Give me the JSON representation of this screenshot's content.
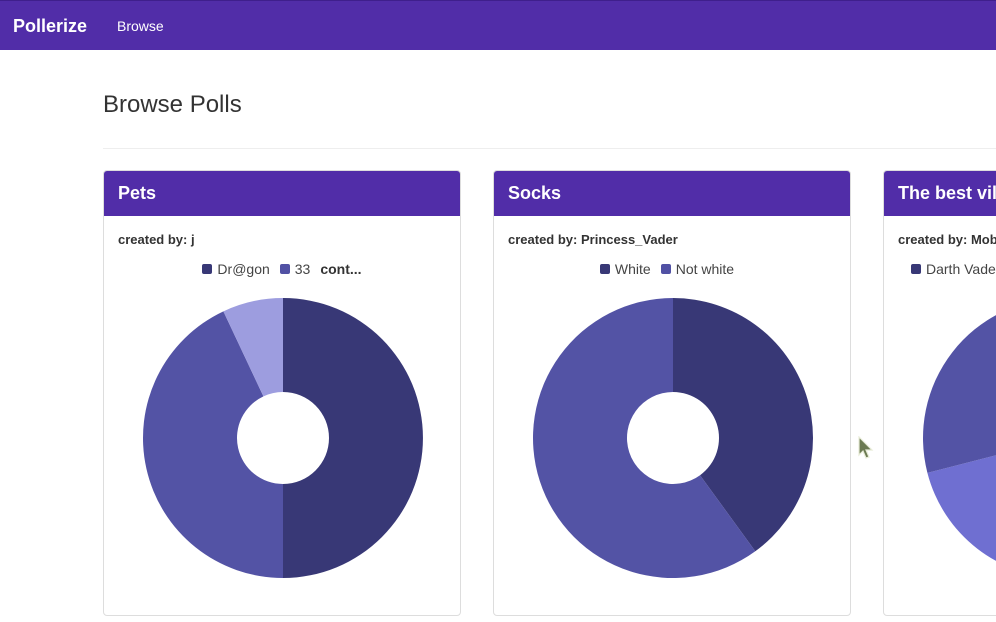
{
  "app": {
    "brand": "Pollerize",
    "nav": {
      "browse_label": "Browse"
    }
  },
  "page": {
    "title": "Browse Polls"
  },
  "polls": [
    {
      "title": "Pets",
      "creator": "created by: j",
      "legend": [
        {
          "label": "Dr@gon",
          "color": "#383876"
        },
        {
          "label": "33",
          "color": "#5151a4"
        }
      ],
      "legend_more": "cont...",
      "chart_data": {
        "type": "pie",
        "donut": true,
        "labels": [
          "Dr@gon",
          "33",
          ""
        ],
        "values": [
          50,
          43,
          7
        ],
        "colors": [
          "#383876",
          "#5353a5",
          "#9d9ddf"
        ]
      }
    },
    {
      "title": "Socks",
      "creator": "created by: Princess_Vader",
      "legend": [
        {
          "label": "White",
          "color": "#383876"
        },
        {
          "label": "Not white",
          "color": "#5151a4"
        }
      ],
      "legend_more": "",
      "chart_data": {
        "type": "pie",
        "donut": true,
        "labels": [
          "White",
          "Not white"
        ],
        "values": [
          40,
          60
        ],
        "colors": [
          "#383876",
          "#5353a5"
        ]
      }
    },
    {
      "title": "The best vil",
      "creator": "created by: Mob",
      "legend": [
        {
          "label": "Darth Vade",
          "color": "#383876"
        }
      ],
      "legend_more": "",
      "chart_data": {
        "type": "pie",
        "donut": true,
        "labels": [
          "Darth Vade",
          "",
          ""
        ],
        "values": [
          29,
          42,
          29
        ],
        "colors": [
          "#383876",
          "#6f6fd1",
          "#5353a5"
        ]
      }
    }
  ]
}
